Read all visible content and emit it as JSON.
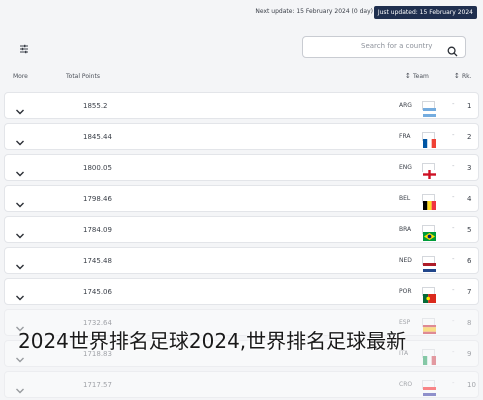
{
  "header": {
    "update_text": "Next update: 15 February 2024 (0 day)",
    "badge_text": "Just updated: 15 February 2024"
  },
  "controls": {
    "filter_icon": "filter-sliders-icon",
    "search_placeholder": "Search for a country",
    "search_icon": "search-icon"
  },
  "table": {
    "columns": {
      "more": "More",
      "total_points": "Total Points",
      "team": "Team",
      "rank": "Rk."
    },
    "sort_icon_glyph": "↕",
    "expand_icon": "chevron-down-icon",
    "rows": [
      {
        "rank": "1",
        "code": "ARG",
        "points": "1855.2",
        "flag": "argentina-flag"
      },
      {
        "rank": "2",
        "code": "FRA",
        "points": "1845.44",
        "flag": "france-flag"
      },
      {
        "rank": "3",
        "code": "ENG",
        "points": "1800.05",
        "flag": "england-flag"
      },
      {
        "rank": "4",
        "code": "BEL",
        "points": "1798.46",
        "flag": "belgium-flag"
      },
      {
        "rank": "5",
        "code": "BRA",
        "points": "1784.09",
        "flag": "brazil-flag"
      },
      {
        "rank": "6",
        "code": "NED",
        "points": "1745.48",
        "flag": "netherlands-flag"
      },
      {
        "rank": "7",
        "code": "POR",
        "points": "1745.06",
        "flag": "portugal-flag"
      },
      {
        "rank": "8",
        "code": "ESP",
        "points": "1732.64",
        "flag": "spain-flag"
      },
      {
        "rank": "9",
        "code": "ITA",
        "points": "1718.83",
        "flag": "italy-flag"
      },
      {
        "rank": "10",
        "code": "CRO",
        "points": "1717.57",
        "flag": "croatia-flag"
      }
    ]
  },
  "overlay_caption": "2024世界排名足球2024,世界排名足球最新"
}
